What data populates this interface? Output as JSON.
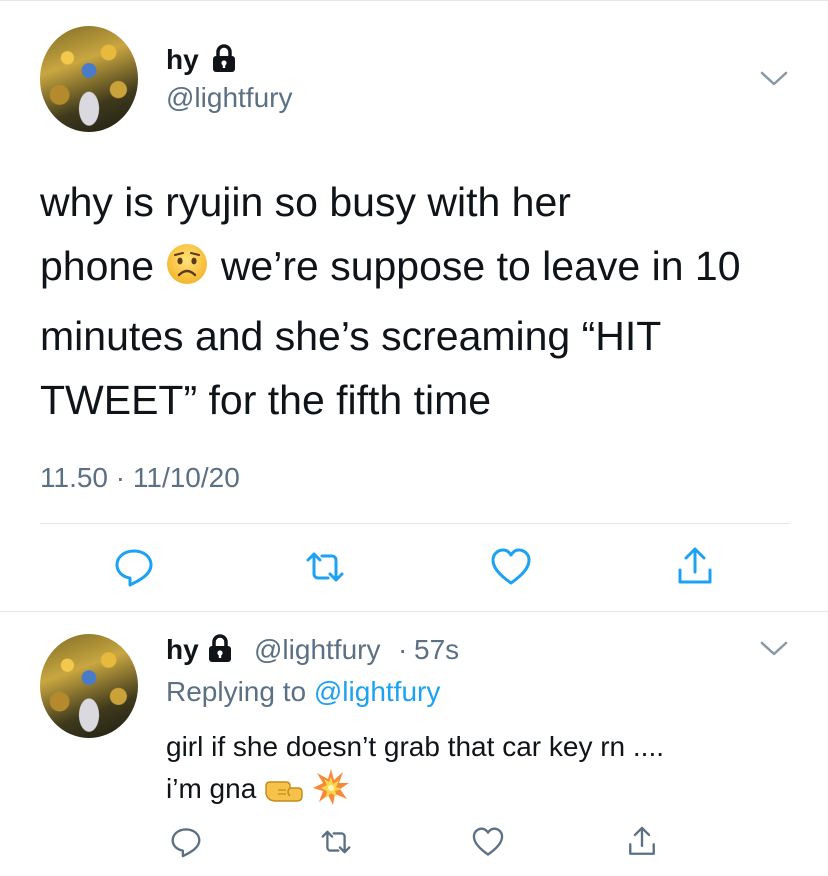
{
  "tweet": {
    "author_name": "hy",
    "handle": "@lightfury",
    "text_line1": "why is ryujin so busy with her",
    "text_line2a": "phone",
    "text_line2b": "we’re suppose to leave in 10",
    "text_line3": "minutes and she’s screaming “HIT",
    "text_line4": "TWEET” for the fifth time",
    "timestamp": "11.50 · 11/10/20",
    "emoji": "worried-face-icon"
  },
  "reply": {
    "author_name": "hy",
    "handle": "@lightfury",
    "separator": "·",
    "age": "57s",
    "replying_prefix": "Replying to",
    "replying_to": "@lightfury",
    "text_line1": "girl if she doesn’t grab that car key rn ....",
    "text_line2": "i’m gna",
    "emojis": [
      "left-facing-fist-icon",
      "collision-icon"
    ]
  },
  "colors": {
    "secondary_text": "#5b7083",
    "link": "#1da1f2",
    "divider": "#e3e6e8"
  }
}
